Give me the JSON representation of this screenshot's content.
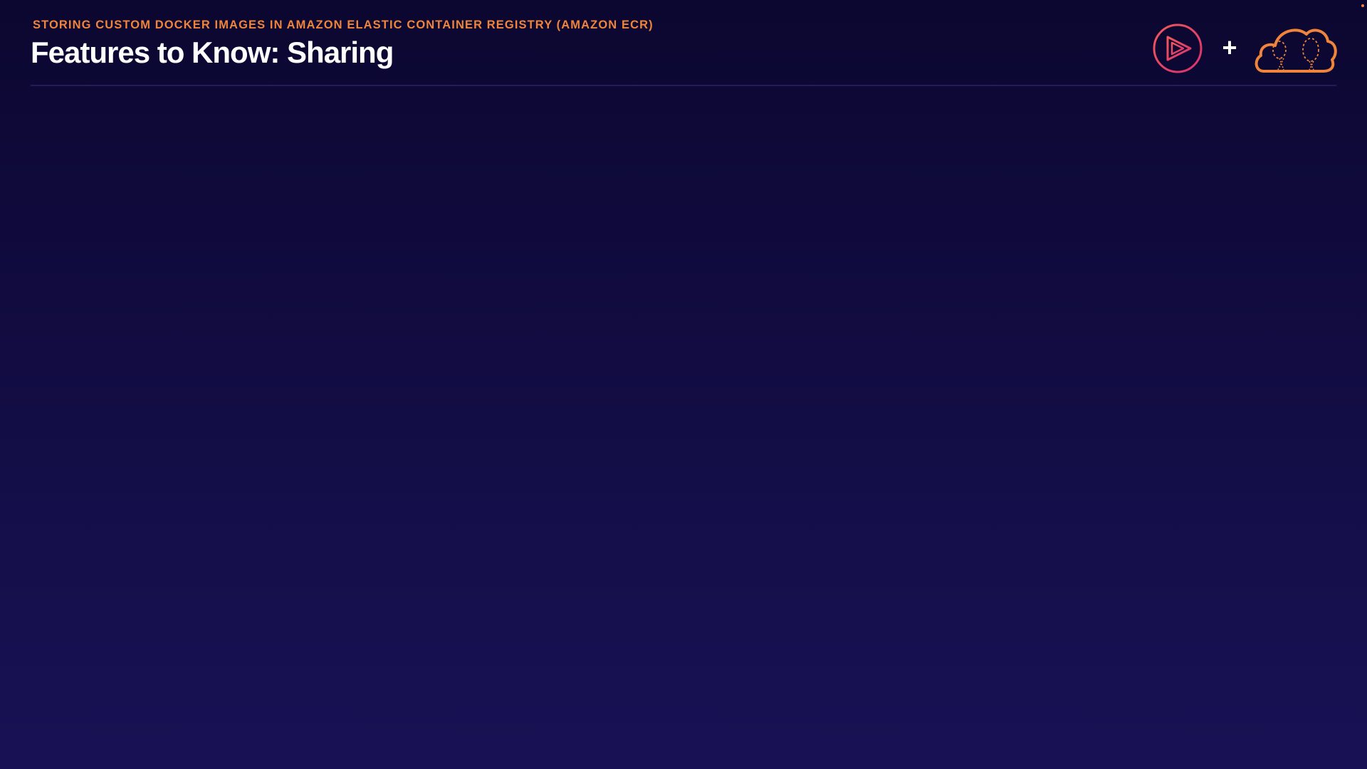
{
  "header": {
    "subtitle": "STORING CUSTOM DOCKER IMAGES IN AMAZON ELASTIC CONTAINER REGISTRY (AMAZON ECR)",
    "title": "Features to Know: Sharing"
  },
  "logos": {
    "left_icon": "play-circle-icon",
    "separator_icon": "plus-icon",
    "separator_glyph": "+",
    "right_icon": "cloud-icon"
  },
  "colors": {
    "accent_orange": "#f0843a",
    "logo_pink": "#e63a6a",
    "title_white": "#ffffff",
    "background_top": "#0b0730",
    "background_bottom": "#181255"
  }
}
